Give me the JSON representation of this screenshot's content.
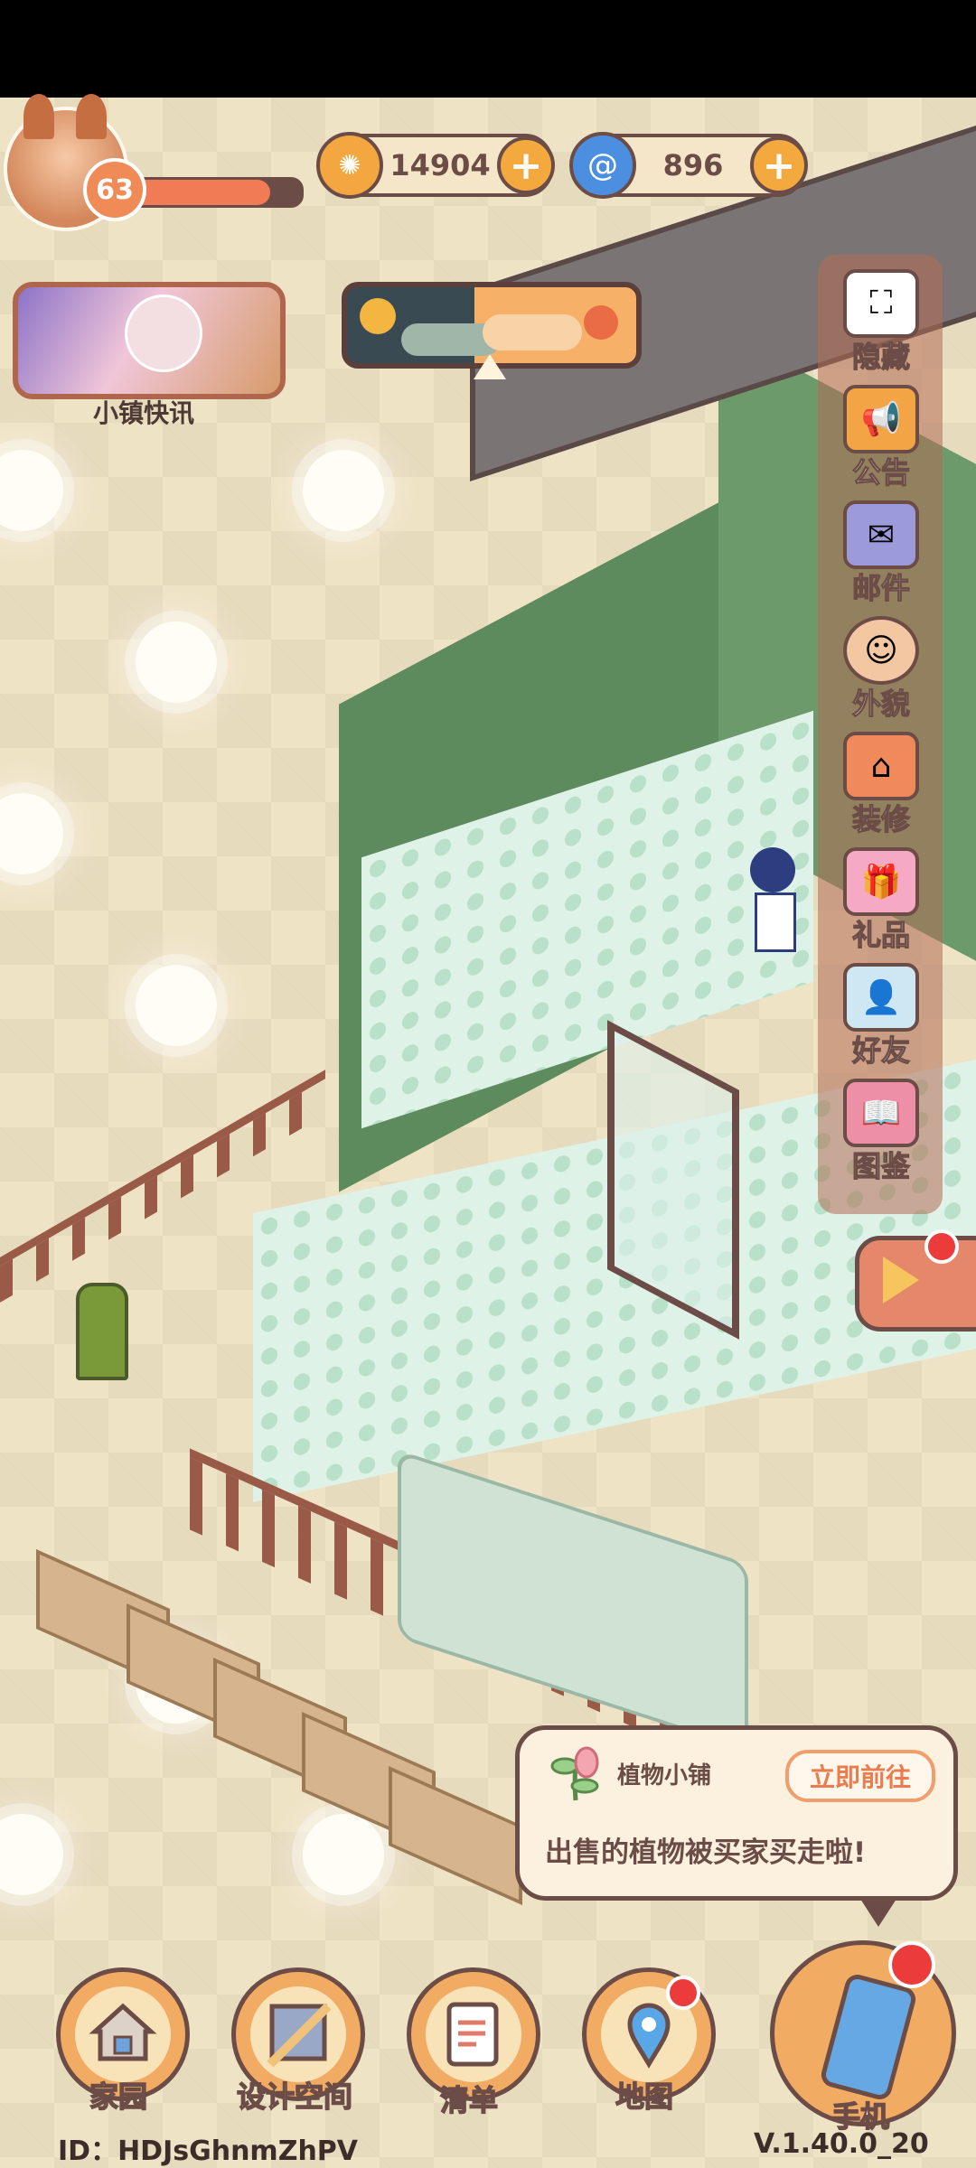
{
  "player": {
    "level": "63",
    "xp_fraction": 0.82
  },
  "currency": {
    "coins": "14904",
    "gems": "896"
  },
  "news": {
    "label": "小镇快讯"
  },
  "side_menu": [
    {
      "label": "隐藏",
      "icon": "scan-frame-icon"
    },
    {
      "label": "公告",
      "icon": "megaphone-icon"
    },
    {
      "label": "邮件",
      "icon": "mail-icon"
    },
    {
      "label": "外貌",
      "icon": "avatar-icon"
    },
    {
      "label": "装修",
      "icon": "house-wrench-icon"
    },
    {
      "label": "礼品",
      "icon": "gift-icon"
    },
    {
      "label": "好友",
      "icon": "friend-card-icon"
    },
    {
      "label": "图鉴",
      "icon": "album-icon"
    }
  ],
  "notification": {
    "title": "植物小铺",
    "action": "立即前往",
    "message": "出售的植物被买家买走啦!"
  },
  "bottom_nav": [
    {
      "label": "家园",
      "icon": "home-icon"
    },
    {
      "label": "设计空间",
      "icon": "design-ruler-icon"
    },
    {
      "label": "清单",
      "icon": "list-icon"
    },
    {
      "label": "地图",
      "icon": "map-pin-icon"
    },
    {
      "label": "手机",
      "icon": "phone-icon"
    }
  ],
  "footer": {
    "id": "ID：HDJsGhnmZhPV",
    "version": "V.1.40.0_20"
  },
  "colors": {
    "outline": "#6b4c46",
    "accent": "#f1ab63",
    "wall": "#5e8b5e",
    "floor": "#dff2e7",
    "badge": "#ec3b3b"
  }
}
